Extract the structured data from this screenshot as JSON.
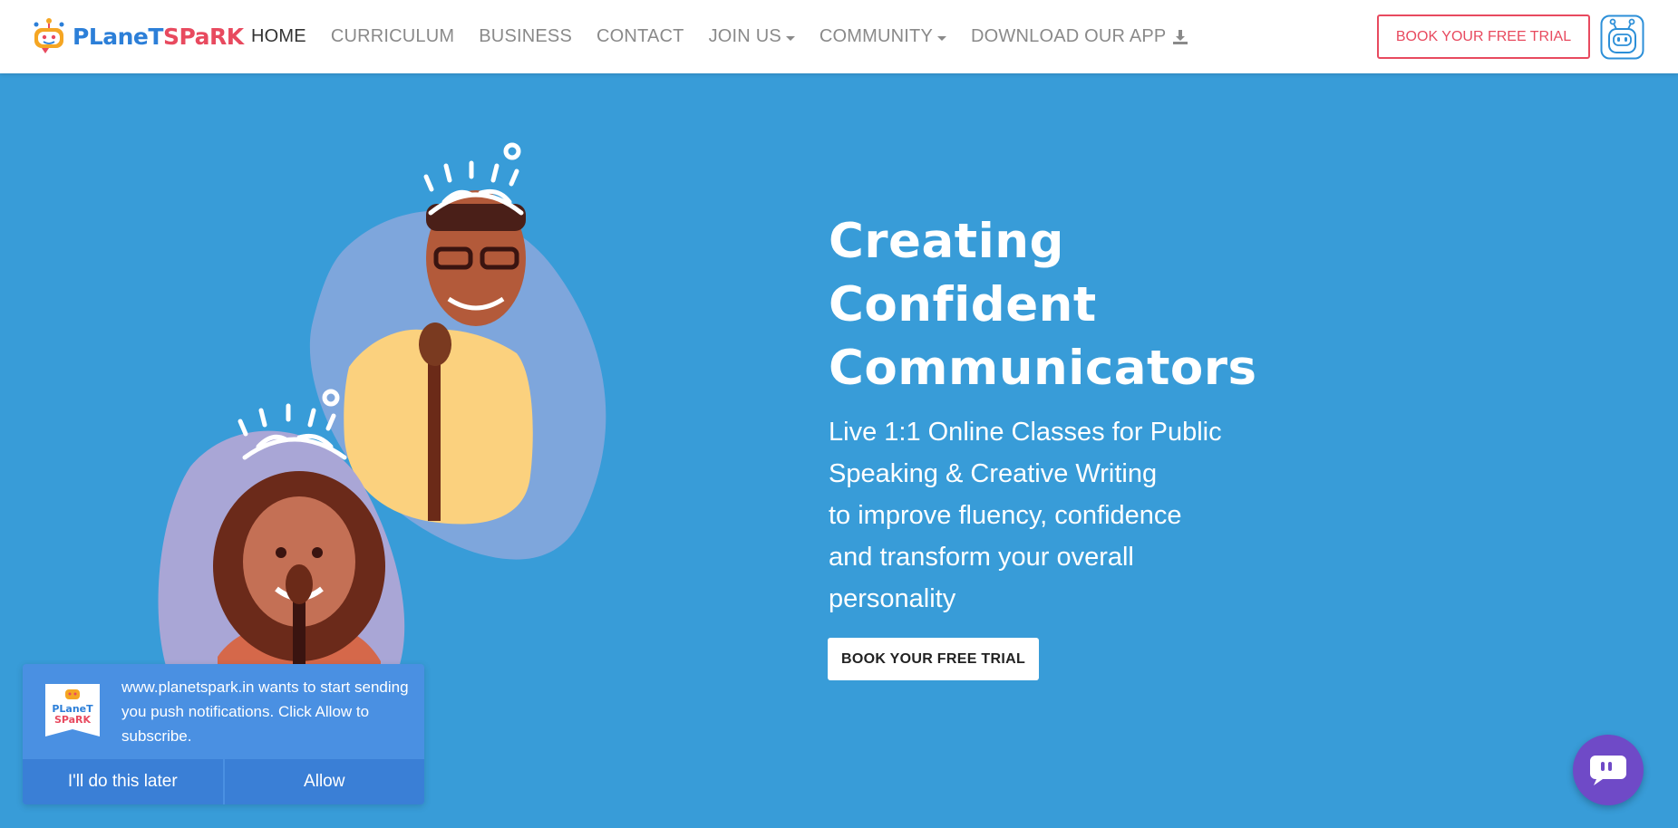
{
  "brand": {
    "logo_left": "PLaneT",
    "logo_right": "SPaRK",
    "primary_color": "#2c7fd8",
    "accent_color": "#e84a5f"
  },
  "nav": {
    "items": [
      {
        "label": "HOME",
        "active": true
      },
      {
        "label": "CURRICULUM",
        "active": false
      },
      {
        "label": "BUSINESS",
        "active": false
      },
      {
        "label": "CONTACT",
        "active": false
      },
      {
        "label": "JOIN US",
        "active": false,
        "icon": "caret-down-icon"
      },
      {
        "label": "COMMUNITY",
        "active": false,
        "icon": "caret-down-icon"
      },
      {
        "label": "DOWNLOAD OUR APP",
        "active": false,
        "icon": "download-icon"
      }
    ],
    "cta_label": "BOOK YOUR FREE TRIAL",
    "robot_icon": "robot-icon"
  },
  "hero": {
    "title_lines": [
      "Creating",
      "Confident",
      "Communicators"
    ],
    "subtitle_lines": [
      "Live 1:1 Online Classes for Public",
      "Speaking & Creative Writing",
      "to improve fluency, confidence",
      "and transform your overall",
      "personality"
    ],
    "cta_label": "BOOK YOUR FREE TRIAL",
    "background_color": "#389cd8"
  },
  "notification": {
    "message": "www.planetspark.in wants to start sending you push notifications. Click Allow to subscribe.",
    "logo_top": "PLaneT",
    "logo_bottom": "SPaRK",
    "later_label": "I'll do this later",
    "allow_label": "Allow"
  },
  "chat": {
    "icon": "chat-icon",
    "color": "#6f4ac7"
  }
}
